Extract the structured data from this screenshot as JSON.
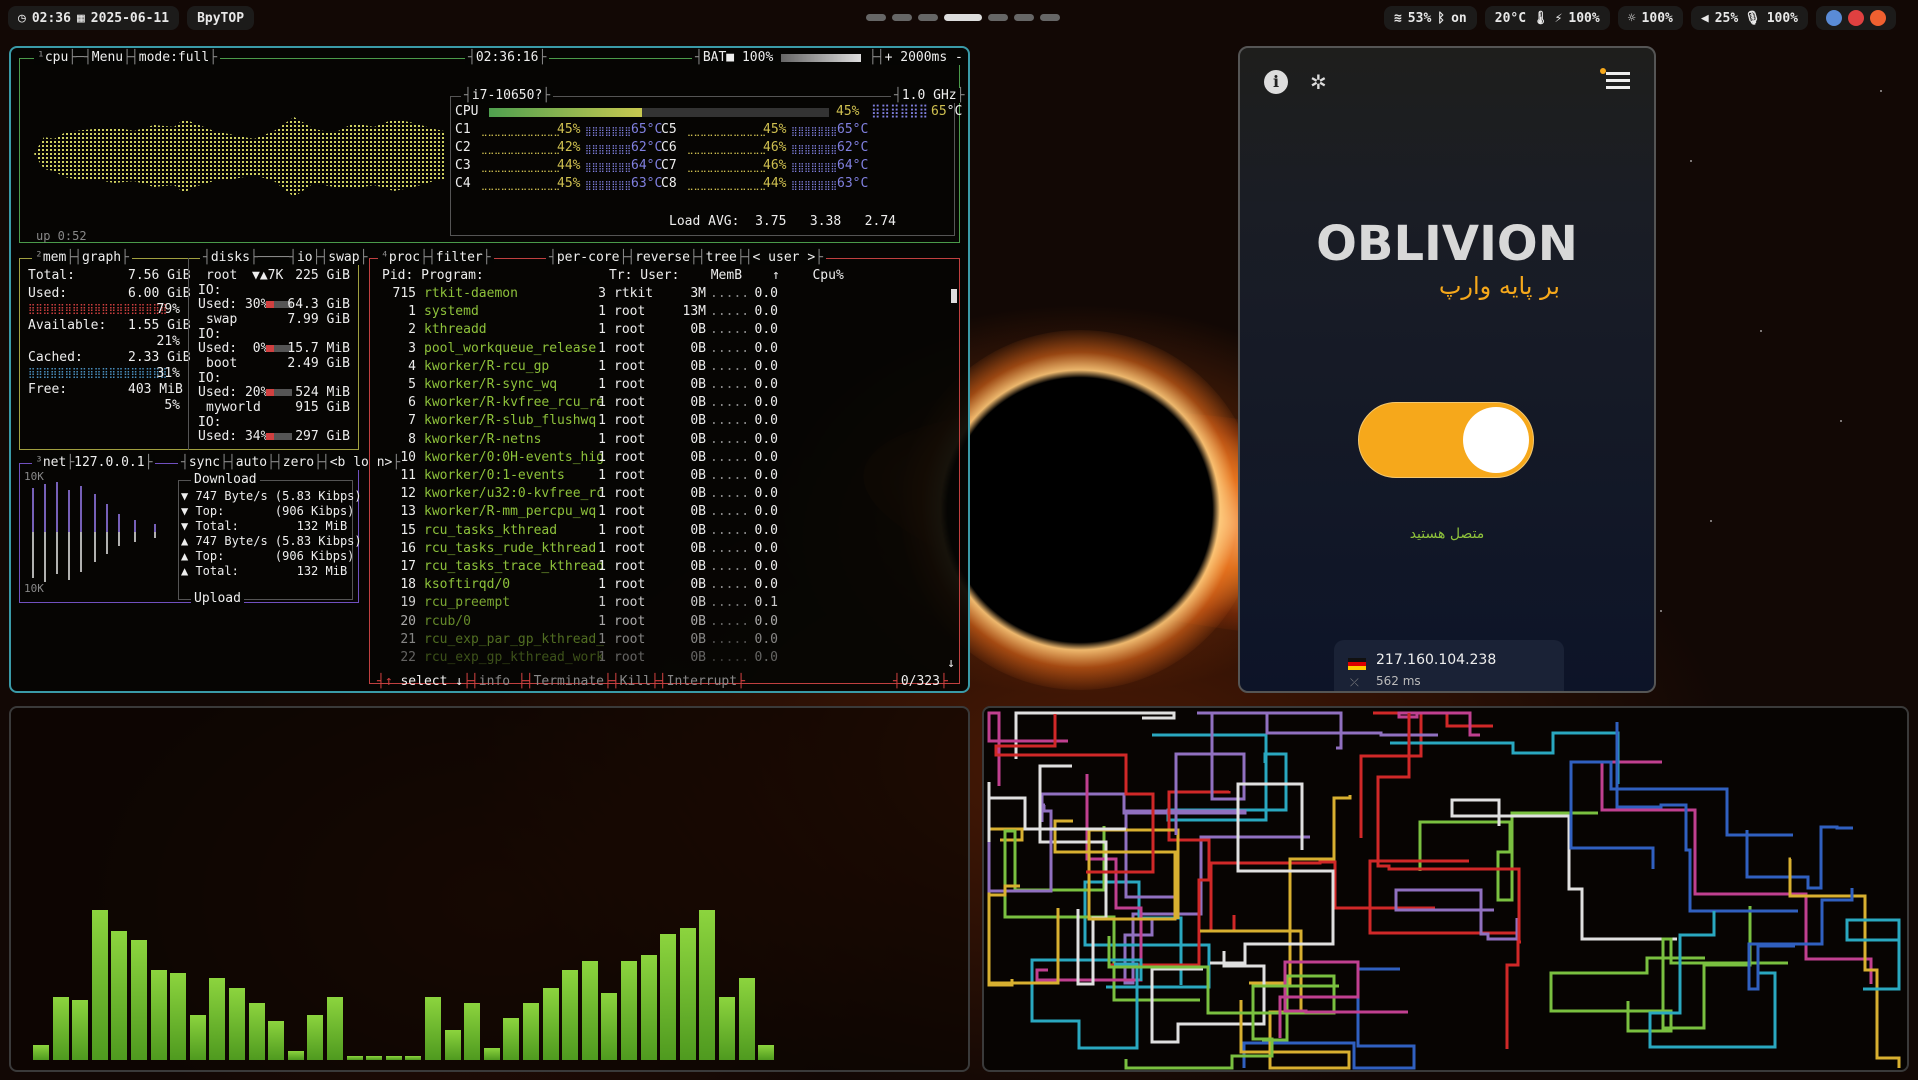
{
  "topbar": {
    "time": "02:36",
    "date": "2025-06-11",
    "app": "BpyTOP",
    "wifi": "53%",
    "bluetooth": "on",
    "temp": "20°C",
    "power": "100%",
    "brightness": "100%",
    "volume": "25%",
    "mic": "100%"
  },
  "btop": {
    "cpu": {
      "title": "cpu",
      "menu": "Menu",
      "mode": "mode:full",
      "clock": "02:36:16",
      "battery": "BAT■ 100%",
      "interval": "+ 2000ms -",
      "model": "i7-10650?",
      "freq": "1.0 GHz",
      "uptime": "up 0:52",
      "total_label": "CPU",
      "total_pct": "45%",
      "cores": [
        {
          "n": "C1",
          "pct": "45%",
          "t": "65°C"
        },
        {
          "n": "C2",
          "pct": "42%",
          "t": "62°C"
        },
        {
          "n": "C3",
          "pct": "44%",
          "t": "64°C"
        },
        {
          "n": "C4",
          "pct": "45%",
          "t": "63°C"
        },
        {
          "n": "C5",
          "pct": "45%",
          "t": "65°C"
        },
        {
          "n": "C6",
          "pct": "46%",
          "t": "62°C"
        },
        {
          "n": "C7",
          "pct": "46%",
          "t": "64°C"
        },
        {
          "n": "C8",
          "pct": "44%",
          "t": "63°C"
        }
      ],
      "load": "Load AVG:  3.75   3.38   2.74"
    },
    "mem": {
      "title": "mem",
      "graph": "graph",
      "total": "7.56 GiB",
      "used": "6.00 GiB",
      "used_pct": "79%",
      "available": "1.55 GiB",
      "available_pct": "21%",
      "cached": "2.33 GiB",
      "cached_pct": "31%",
      "free": "403 MiB",
      "free_pct": "5%"
    },
    "disks": {
      "title": "disks",
      "io": "io",
      "swap": "swap",
      "items": [
        {
          "name": "root",
          "extra": "▼▲7K",
          "size": "225 GiB",
          "used": "Used: 30%",
          "used_val": "64.3 GiB"
        },
        {
          "name": "swap",
          "extra": "",
          "size": "7.99 GiB",
          "used": "Used:  0%",
          "used_val": "15.7 MiB"
        },
        {
          "name": "boot",
          "extra": "",
          "size": "2.49 GiB",
          "used": "Used: 20%",
          "used_val": "524 MiB"
        },
        {
          "name": "myworld",
          "extra": "",
          "size": "915 GiB",
          "used": "Used: 34%",
          "used_val": "297 GiB"
        }
      ]
    },
    "net": {
      "title": "net",
      "ip": "127.0.0.1",
      "sync": "sync",
      "auto": "auto",
      "zero": "zero",
      "iface": "<b lo n>",
      "scale_top": "10K",
      "scale_bottom": "10K",
      "download": "Download",
      "upload": "Upload",
      "rows": [
        "▼ 747 Byte/s (5.83 Kibps)",
        "▼ Top:       (906 Kibps)",
        "▼ Total:        132 MiB",
        "▲ 747 Byte/s (5.83 Kibps)",
        "▲ Top:       (906 Kibps)",
        "▲ Total:        132 MiB"
      ]
    },
    "proc": {
      "title": "proc",
      "filter": "filter",
      "per_core": "per-core",
      "reverse": "reverse",
      "tree": "tree",
      "user": "< user >",
      "header": "Pid: Program:                Tr: User:    MemB         Cpu%",
      "rows": [
        {
          "pid": "715",
          "prog": "rtkit-daemon",
          "tr": "3",
          "user": "rtkit",
          "mem": "3M",
          "cpu": "0.0"
        },
        {
          "pid": "1",
          "prog": "systemd",
          "tr": "1",
          "user": "root",
          "mem": "13M",
          "cpu": "0.0"
        },
        {
          "pid": "2",
          "prog": "kthreadd",
          "tr": "1",
          "user": "root",
          "mem": "0B",
          "cpu": "0.0"
        },
        {
          "pid": "3",
          "prog": "pool_workqueue_release",
          "tr": "1",
          "user": "root",
          "mem": "0B",
          "cpu": "0.0"
        },
        {
          "pid": "4",
          "prog": "kworker/R-rcu_gp",
          "tr": "1",
          "user": "root",
          "mem": "0B",
          "cpu": "0.0"
        },
        {
          "pid": "5",
          "prog": "kworker/R-sync_wq",
          "tr": "1",
          "user": "root",
          "mem": "0B",
          "cpu": "0.0"
        },
        {
          "pid": "6",
          "prog": "kworker/R-kvfree_rcu_re",
          "tr": "1",
          "user": "root",
          "mem": "0B",
          "cpu": "0.0"
        },
        {
          "pid": "7",
          "prog": "kworker/R-slub_flushwq",
          "tr": "1",
          "user": "root",
          "mem": "0B",
          "cpu": "0.0"
        },
        {
          "pid": "8",
          "prog": "kworker/R-netns",
          "tr": "1",
          "user": "root",
          "mem": "0B",
          "cpu": "0.0"
        },
        {
          "pid": "10",
          "prog": "kworker/0:0H-events_hig",
          "tr": "1",
          "user": "root",
          "mem": "0B",
          "cpu": "0.0"
        },
        {
          "pid": "11",
          "prog": "kworker/0:1-events",
          "tr": "1",
          "user": "root",
          "mem": "0B",
          "cpu": "0.0"
        },
        {
          "pid": "12",
          "prog": "kworker/u32:0-kvfree_rc",
          "tr": "1",
          "user": "root",
          "mem": "0B",
          "cpu": "0.0"
        },
        {
          "pid": "13",
          "prog": "kworker/R-mm_percpu_wq",
          "tr": "1",
          "user": "root",
          "mem": "0B",
          "cpu": "0.0"
        },
        {
          "pid": "15",
          "prog": "rcu_tasks_kthread",
          "tr": "1",
          "user": "root",
          "mem": "0B",
          "cpu": "0.0"
        },
        {
          "pid": "16",
          "prog": "rcu_tasks_rude_kthread",
          "tr": "1",
          "user": "root",
          "mem": "0B",
          "cpu": "0.0"
        },
        {
          "pid": "17",
          "prog": "rcu_tasks_trace_kthread",
          "tr": "1",
          "user": "root",
          "mem": "0B",
          "cpu": "0.0"
        },
        {
          "pid": "18",
          "prog": "ksoftirqd/0",
          "tr": "1",
          "user": "root",
          "mem": "0B",
          "cpu": "0.0"
        },
        {
          "pid": "19",
          "prog": "rcu_preempt",
          "tr": "1",
          "user": "root",
          "mem": "0B",
          "cpu": "0.1"
        },
        {
          "pid": "20",
          "prog": "rcub/0",
          "tr": "1",
          "user": "root",
          "mem": "0B",
          "cpu": "0.0"
        },
        {
          "pid": "21",
          "prog": "rcu_exp_par_gp_kthread_",
          "tr": "1",
          "user": "root",
          "mem": "0B",
          "cpu": "0.0"
        },
        {
          "pid": "22",
          "prog": "rcu_exp_gp_kthread_work",
          "tr": "1",
          "user": "root",
          "mem": "0B",
          "cpu": "0.0"
        }
      ],
      "footer_select": "select",
      "footer_info": "info",
      "footer_terminate": "Terminate",
      "footer_kill": "Kill",
      "footer_interrupt": "Interrupt",
      "count": "0/323"
    }
  },
  "visualizer": {
    "levels": [
      0.1,
      0.42,
      0.4,
      1.0,
      0.86,
      0.8,
      0.6,
      0.58,
      0.3,
      0.55,
      0.48,
      0.38,
      0.26,
      0.06,
      0.3,
      0.42,
      0.02,
      0.02,
      0.02,
      0.02,
      0.42,
      0.2,
      0.38,
      0.08,
      0.28,
      0.38,
      0.48,
      0.6,
      0.66,
      0.45,
      0.66,
      0.7,
      0.84,
      0.88,
      1.0,
      0.42,
      0.55,
      0.1
    ]
  },
  "oblivion": {
    "title": "OBLIVION",
    "subtitle": "بر پایه وارپ",
    "status": "متصل هستید",
    "ip": "217.160.104.238",
    "ping": "562 ms"
  }
}
